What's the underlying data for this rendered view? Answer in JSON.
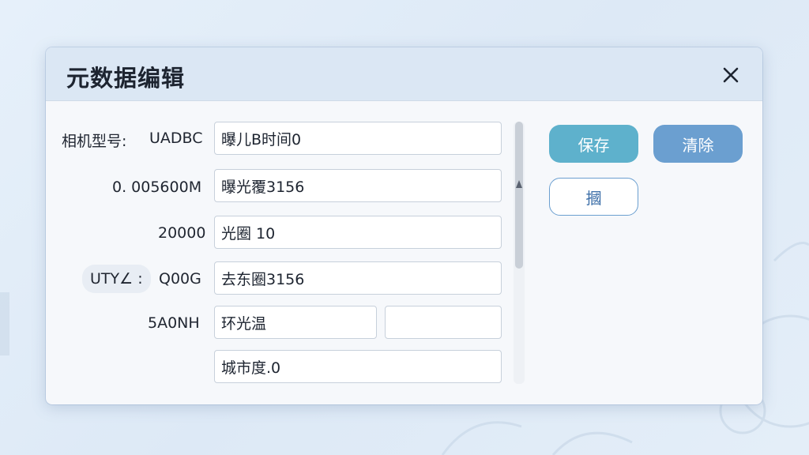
{
  "dialog": {
    "title": "元数据编辑",
    "close_icon": "close-icon"
  },
  "fields": {
    "row1": {
      "label": "相机型号:",
      "code": "UADBC",
      "value": "曝儿B时间0"
    },
    "row2": {
      "label": "0. 005600M",
      "value": "曝光覆3156"
    },
    "row3": {
      "label": "20000",
      "value": "光圈 10"
    },
    "row4": {
      "chip": "UTY∠ :",
      "label": "Q00G",
      "value": "去东圈3156"
    },
    "row5": {
      "label": "5A0NH",
      "value": "环光温",
      "value2": ""
    },
    "row6": {
      "value": "城市度.0"
    }
  },
  "buttons": {
    "save": "保存",
    "clear": "清除",
    "third": "摑"
  },
  "colors": {
    "save_button": "#5eb1cc",
    "clear_button": "#6b9fd0",
    "header_bg": "#dbe7f4"
  }
}
